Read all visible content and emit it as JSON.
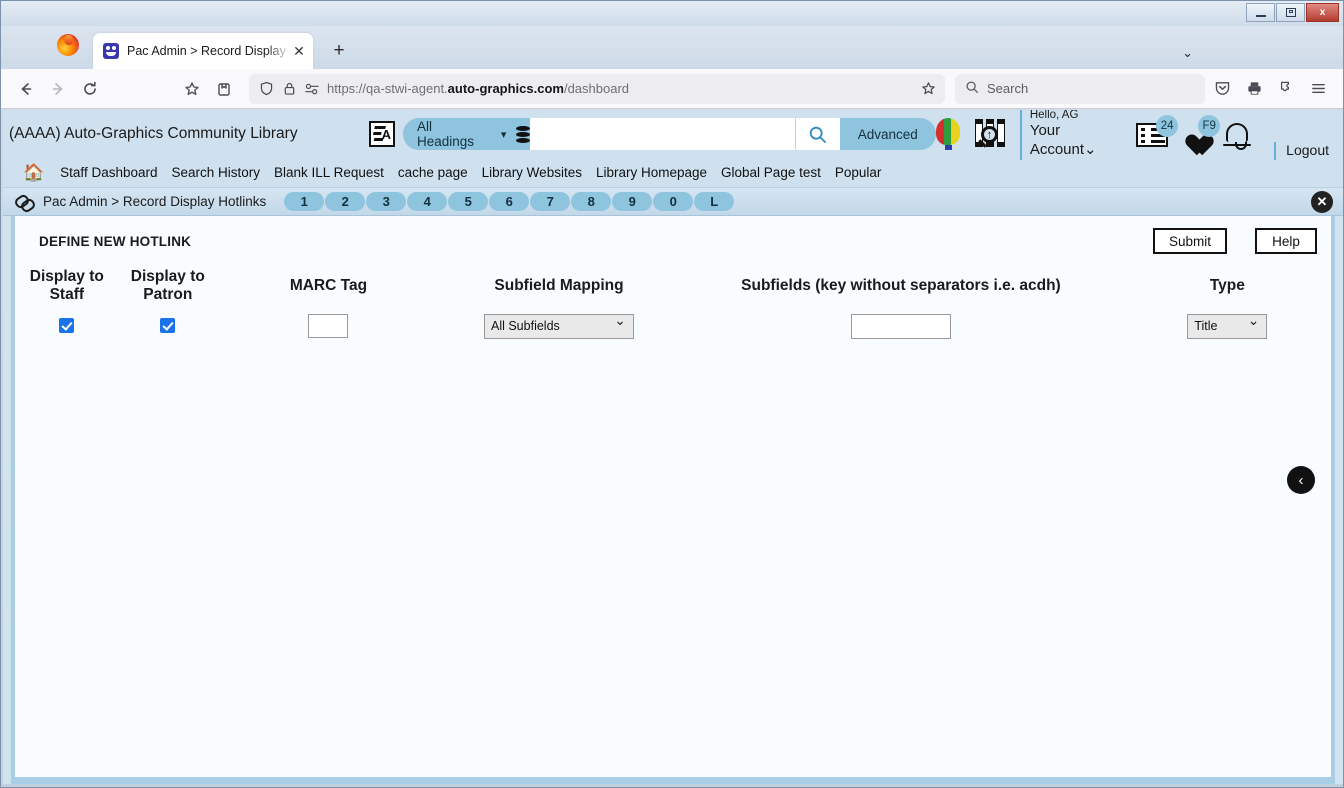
{
  "window": {
    "minimize_label": "Minimize",
    "restore_label": "Restore",
    "close_label": "x"
  },
  "browser": {
    "tab": {
      "title": "Pac Admin > Record Display Ho",
      "close_label": "✕",
      "favicon_name": "pac-admin-favicon"
    },
    "new_tab_label": "+",
    "tab_list_chevron": "⌄",
    "toolbar": {
      "back_label": "←",
      "forward_label": "→",
      "reload_label": "↻",
      "bookmark_label": "☆",
      "save_tab_label": "⧉",
      "shield_label": "◯",
      "lock_label": "⚿",
      "permissions_label": "≡",
      "pocket_label": "▽",
      "print_label": "⎙",
      "extensions_label": "❖",
      "menu_label": "≡"
    },
    "url": {
      "prefix": "https://qa-stwi-agent.",
      "domain": "auto-graphics.com",
      "suffix": "/dashboard"
    },
    "search": {
      "placeholder": "Search",
      "value": "Search"
    }
  },
  "site": {
    "library_name": "(AAAA) Auto-Graphics Community Library",
    "search_scope": "All Headings",
    "search_value": "",
    "search_placeholder": "",
    "advanced_label": "Advanced",
    "account": {
      "hello": "Hello, AG",
      "name": "Your Account⌄"
    },
    "logout_label": "Logout",
    "badges": {
      "list_count": "24",
      "favorites_count": "F9"
    },
    "nav_links": [
      {
        "label": "Staff Dashboard"
      },
      {
        "label": "Search History"
      },
      {
        "label": "Blank ILL Request"
      },
      {
        "label": "cache page"
      },
      {
        "label": "Library Websites"
      },
      {
        "label": "Library Homepage"
      },
      {
        "label": "Global Page test"
      },
      {
        "label": "Popular"
      }
    ]
  },
  "breadcrumb": {
    "text": "Pac Admin > Record Display Hotlinks",
    "hotkeys": [
      "1",
      "2",
      "3",
      "4",
      "5",
      "6",
      "7",
      "8",
      "9",
      "0",
      "L"
    ],
    "close_label": "✕"
  },
  "main": {
    "section_title": "DEFINE NEW HOTLINK",
    "submit_label": "Submit",
    "help_label": "Help",
    "back_label": "‹",
    "columns": [
      {
        "label": "Display to Staff"
      },
      {
        "label": "Display to Patron"
      },
      {
        "label": "MARC Tag"
      },
      {
        "label": "Subfield Mapping"
      },
      {
        "label": "Subfields (key without separators i.e. acdh)"
      },
      {
        "label": "Type"
      }
    ],
    "row": {
      "display_to_staff_checked": true,
      "display_to_patron_checked": true,
      "marc_tag_value": "",
      "subfield_mapping_value": "All Subfields",
      "subfield_mapping_options": [
        "All Subfields"
      ],
      "subfields_value": "",
      "type_value": "Title",
      "type_options": [
        "Title"
      ]
    }
  },
  "colors": {
    "header_blue": "#cfe1ee",
    "accent_blue": "#8ec4de",
    "checkbox_blue": "#1a73e8",
    "card_bg": "#f8fcff",
    "card_border": "#a9cfe6"
  }
}
